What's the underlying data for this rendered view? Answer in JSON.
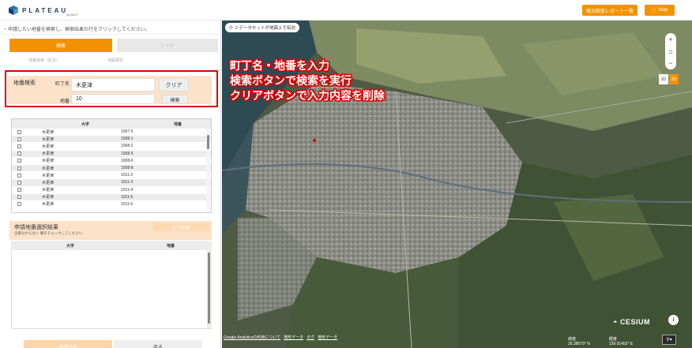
{
  "header": {
    "logo_text": "PLATEAU",
    "logo_sub": "by MLIT",
    "report_button": "概況調査レポート一覧",
    "help_button": "Help"
  },
  "left": {
    "instruction": "・申請したい地番を検索し、検索結果の行をクリックしてください。",
    "tab_search": "検索",
    "tab_layer": "レイヤ",
    "radio_1": "地番検索（町名）",
    "radio_2": "地図選択",
    "search": {
      "title": "地番検索",
      "town_label": "町丁名",
      "town_value": "木更津",
      "lot_label": "地番",
      "lot_value": "10",
      "clear_button": "クリア",
      "search_button": "検索"
    },
    "results": {
      "col_aza": "大字",
      "col_lot": "地番",
      "rows": [
        {
          "aza": "木更津",
          "lot": "1007-5"
        },
        {
          "aza": "木更津",
          "lot": "1008-1"
        },
        {
          "aza": "木更津",
          "lot": "1008-2"
        },
        {
          "aza": "木更津",
          "lot": "1008-5"
        },
        {
          "aza": "木更津",
          "lot": "1008-6"
        },
        {
          "aza": "木更津",
          "lot": "1008-8"
        },
        {
          "aza": "木更津",
          "lot": "1011-2"
        },
        {
          "aza": "木更津",
          "lot": "1011-3"
        },
        {
          "aza": "木更津",
          "lot": "1011-4"
        },
        {
          "aza": "木更津",
          "lot": "1011-5"
        },
        {
          "aza": "木更津",
          "lot": "1011-6"
        }
      ]
    },
    "selection": {
      "title": "申請地番選択結果",
      "subtitle": "全部分からない 番をチェックしてください",
      "clear_all": "全て削除",
      "col_aza": "大字",
      "col_lot": "地番"
    },
    "apply_button": "申請対象",
    "back_button": "戻る"
  },
  "map": {
    "dataset_badge": "2 データセットが地図上で有効",
    "annotation_lines": [
      "町丁名・地番を入力",
      "検索ボタンで検索を実行",
      "クリアボタンで入力内容を削除"
    ],
    "zoom_in": "+",
    "home": "⌂",
    "zoom_out": "−",
    "mode_3d": "3D",
    "mode_2d": "2D",
    "cesium_label": "CESIUM",
    "footer_links": [
      "Google Analyticsの利用について",
      "地形データ",
      "タグ",
      "地形データ"
    ],
    "lat_label": "緯度",
    "lat_value": "35.38079° N",
    "lon_label": "経度",
    "lon_value": "139.91452° E"
  },
  "colors": {
    "accent": "#f39200",
    "accent_light": "#fbe2c8",
    "highlight_red": "#e00000"
  }
}
